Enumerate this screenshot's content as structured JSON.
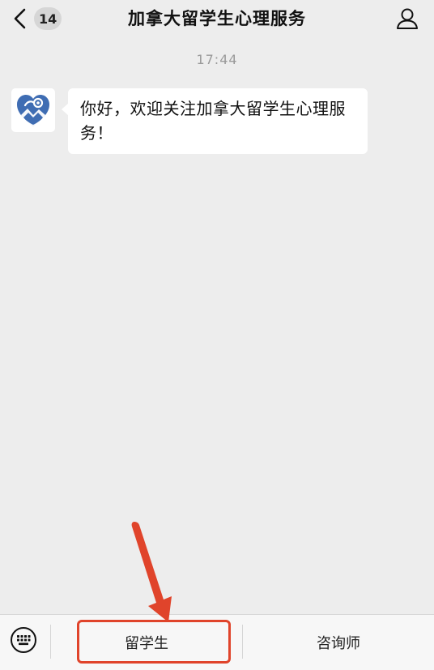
{
  "header": {
    "back_icon": "chevron-left-icon",
    "unread_count": "14",
    "title": "加拿大留学生心理服务",
    "profile_icon": "person-icon"
  },
  "chat": {
    "timestamp": "17:44",
    "messages": [
      {
        "sender_avatar": "heart-logo-icon",
        "text": "你好，欢迎关注加拿大留学生心理服务！"
      }
    ]
  },
  "bottom_menu": {
    "keyboard_icon": "keyboard-icon",
    "items": [
      {
        "label": "留学生"
      },
      {
        "label": "咨询师"
      }
    ]
  },
  "annotation": {
    "highlight_color": "#e0442b",
    "arrow_icon": "red-arrow-icon"
  }
}
